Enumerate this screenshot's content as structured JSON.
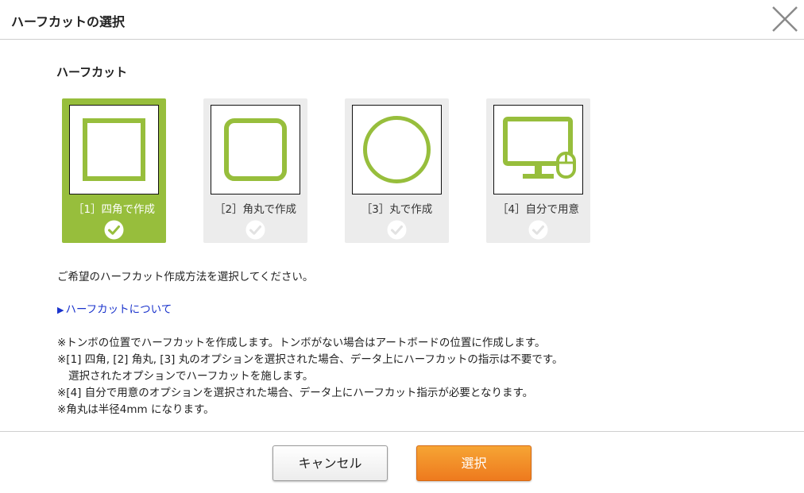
{
  "dialog": {
    "title": "ハーフカットの選択"
  },
  "section": {
    "title": "ハーフカット"
  },
  "options": [
    {
      "label": "［1］四角で作成",
      "selected": true,
      "icon": "square-shape-icon"
    },
    {
      "label": "［2］角丸で作成",
      "selected": false,
      "icon": "rounded-square-shape-icon"
    },
    {
      "label": "［3］丸で作成",
      "selected": false,
      "icon": "circle-shape-icon"
    },
    {
      "label": "［4］自分で用意",
      "selected": false,
      "icon": "monitor-mouse-icon"
    }
  ],
  "description": "ご希望のハーフカット作成方法を選択してください。",
  "link": {
    "text": "ハーフカットについて"
  },
  "notes": [
    "※トンボの位置でハーフカットを作成します。トンボがない場合はアートボードの位置に作成します。",
    "※[1] 四角, [2] 角丸, [3] 丸のオプションを選択された場合、データ上にハーフカットの指示は不要です。",
    "選択されたオプションでハーフカットを施します。",
    "※[4] 自分で用意のオプションを選択された場合、データ上にハーフカット指示が必要となります。",
    "※角丸は半径4mm になります。"
  ],
  "buttons": {
    "cancel": "キャンセル",
    "select": "選択"
  },
  "colors": {
    "accent_green": "#97be3c",
    "card_gray": "#ececec",
    "link_blue": "#1a33cc",
    "select_orange": "#f08a24"
  }
}
